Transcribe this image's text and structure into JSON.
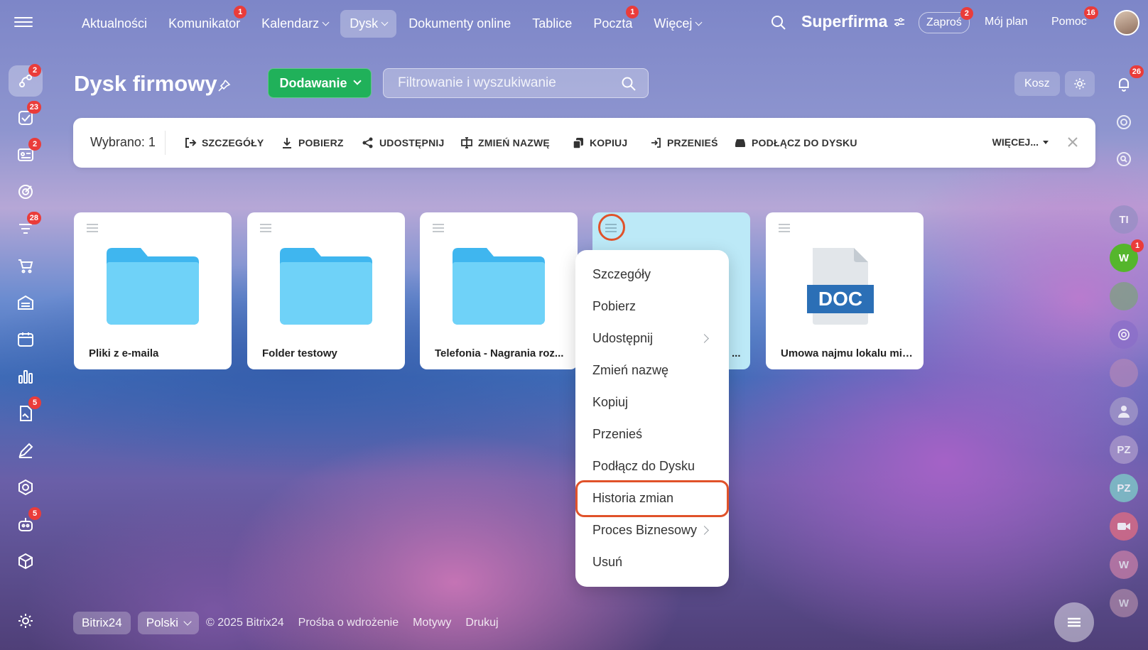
{
  "topbar": {
    "nav": [
      {
        "label": "Aktualności",
        "badge": ""
      },
      {
        "label": "Komunikator",
        "badge": "1"
      },
      {
        "label": "Kalendarz",
        "badge": "",
        "dropdown": true
      },
      {
        "label": "Dysk",
        "badge": "",
        "dropdown": true,
        "active": true
      },
      {
        "label": "Dokumenty online",
        "badge": ""
      },
      {
        "label": "Tablice",
        "badge": ""
      },
      {
        "label": "Poczta",
        "badge": "1"
      },
      {
        "label": "Więcej",
        "badge": "",
        "dropdown": true
      }
    ],
    "brand": "Superfirma",
    "invite_label": "Zaproś",
    "invite_badge": "2",
    "plan_label": "Mój plan",
    "help_label": "Pomoc",
    "help_badge": "16"
  },
  "sidebar": {
    "badges": {
      "feed": "2",
      "tasks": "23",
      "crm": "2",
      "sales": "28",
      "sign": "5",
      "bot": "5"
    }
  },
  "page": {
    "title": "Dysk firmowy",
    "add_label": "Dodawanie",
    "filter_placeholder": "Filtrowanie i wyszukiwanie",
    "trash_label": "Kosz"
  },
  "toolbar": {
    "selected": "Wybrano: 1",
    "actions": [
      "SZCZEGÓŁY",
      "POBIERZ",
      "UDOSTĘPNIJ",
      "ZMIEŃ NAZWĘ",
      "KOPIUJ",
      "PRZENIEŚ",
      "PODŁĄCZ DO DYSKU"
    ],
    "more": "WIĘCEJ..."
  },
  "files": [
    {
      "name": "Pliki z e-maila",
      "type": "folder"
    },
    {
      "name": "Folder testowy",
      "type": "folder"
    },
    {
      "name": "Telefonia - Nagrania roz...",
      "type": "folder"
    },
    {
      "name": "...",
      "type": "selected"
    },
    {
      "name": "Umowa najmu lokalu mie...",
      "type": "doc",
      "ext": "DOC"
    }
  ],
  "context_menu": {
    "items": [
      {
        "label": "Szczegóły"
      },
      {
        "label": "Pobierz"
      },
      {
        "label": "Udostępnij",
        "submenu": true
      },
      {
        "label": "Zmień nazwę"
      },
      {
        "label": "Kopiuj"
      },
      {
        "label": "Przenieś"
      },
      {
        "label": "Podłącz do Dysku"
      },
      {
        "label": "Historia zmian",
        "highlighted": true
      },
      {
        "label": "Proces Biznesowy",
        "submenu": true
      },
      {
        "label": "Usuń"
      }
    ]
  },
  "right_rail": {
    "notifications_badge": "26",
    "users": [
      {
        "initials": "TI",
        "color": "#9a8fc6"
      },
      {
        "initials": "W",
        "color": "#55b62c",
        "badge": "1"
      },
      {
        "initials": "PZ",
        "color": "#a695c9"
      },
      {
        "initials": "PZ",
        "color": "#7dc3c7"
      },
      {
        "initials": "W",
        "color": "#c77ea6"
      },
      {
        "initials": "W",
        "color": "#b08aa9"
      }
    ]
  },
  "footer": {
    "brand": "Bitrix24",
    "language": "Polski",
    "copyright": "© 2025 Bitrix24",
    "links": [
      "Prośba o wdrożenie",
      "Motywy",
      "Drukuj"
    ]
  },
  "colors": {
    "accent_green": "#20b15a",
    "badge_red": "#ea3c3a",
    "highlight_orange": "#e0522a",
    "selected_tile": "#bce9f7",
    "folder": "#5ec8f2"
  }
}
